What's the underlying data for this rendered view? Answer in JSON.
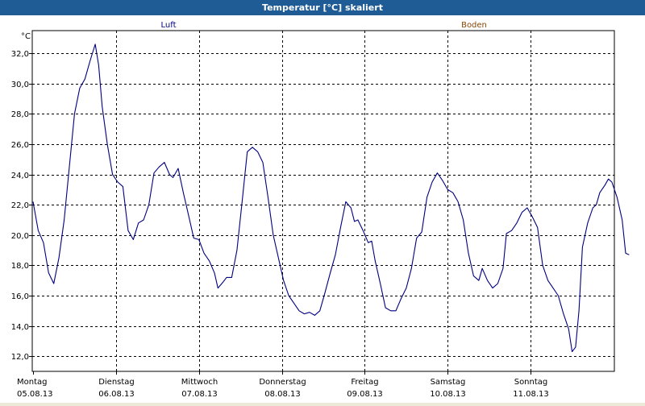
{
  "window": {
    "title": "Temperatur [°C] skaliert"
  },
  "colors": {
    "titlebar": "#1f5c96",
    "series_luft": "#000080",
    "series_boden": "#8b4500",
    "grid": "#000000"
  },
  "chart_data": {
    "type": "line",
    "title": "Temperatur [°C] skaliert",
    "ylabel": "°C",
    "ylim": [
      11.0,
      33.5
    ],
    "xlim": [
      "2013-08-05",
      "2013-08-12"
    ],
    "grid": true,
    "legend": [
      "Luft",
      "Boden"
    ],
    "yticks": [
      "12,0",
      "14,0",
      "16,0",
      "18,0",
      "20,0",
      "22,0",
      "24,0",
      "26,0",
      "28,0",
      "30,0",
      "32,0"
    ],
    "xticks": [
      {
        "day": "Montag",
        "date": "05.08.13"
      },
      {
        "day": "Dienstag",
        "date": "06.08.13"
      },
      {
        "day": "Mittwoch",
        "date": "07.08.13"
      },
      {
        "day": "Donnerstag",
        "date": "08.08.13"
      },
      {
        "day": "Freitag",
        "date": "09.08.13"
      },
      {
        "day": "Samstag",
        "date": "10.08.13"
      },
      {
        "day": "Sonntag",
        "date": "11.08.13"
      }
    ],
    "series": [
      {
        "name": "Luft",
        "points": [
          [
            "2013-08-05 00:00",
            22.2
          ],
          [
            "2013-08-05 01:30",
            20.3
          ],
          [
            "2013-08-05 03:00",
            19.5
          ],
          [
            "2013-08-05 04:30",
            17.5
          ],
          [
            "2013-08-05 06:00",
            16.8
          ],
          [
            "2013-08-05 07:30",
            18.5
          ],
          [
            "2013-08-05 09:00",
            21.0
          ],
          [
            "2013-08-05 10:30",
            24.5
          ],
          [
            "2013-08-05 12:00",
            28.0
          ],
          [
            "2013-08-05 13:30",
            29.7
          ],
          [
            "2013-08-05 15:00",
            30.3
          ],
          [
            "2013-08-05 16:30",
            31.5
          ],
          [
            "2013-08-05 18:00",
            32.6
          ],
          [
            "2013-08-05 19:00",
            31.2
          ],
          [
            "2013-08-05 20:00",
            28.5
          ],
          [
            "2013-08-05 21:30",
            26.0
          ],
          [
            "2013-08-05 23:00",
            24.0
          ],
          [
            "2013-08-06 00:30",
            23.5
          ],
          [
            "2013-08-06 02:00",
            23.2
          ],
          [
            "2013-08-06 03:30",
            20.3
          ],
          [
            "2013-08-06 05:00",
            19.7
          ],
          [
            "2013-08-06 06:30",
            20.8
          ],
          [
            "2013-08-06 08:00",
            21.0
          ],
          [
            "2013-08-06 09:30",
            22.0
          ],
          [
            "2013-08-06 11:00",
            24.1
          ],
          [
            "2013-08-06 12:30",
            24.5
          ],
          [
            "2013-08-06 14:00",
            24.8
          ],
          [
            "2013-08-06 15:30",
            24.0
          ],
          [
            "2013-08-06 16:30",
            23.8
          ],
          [
            "2013-08-06 18:00",
            24.4
          ],
          [
            "2013-08-06 19:30",
            22.8
          ],
          [
            "2013-08-06 21:00",
            21.3
          ],
          [
            "2013-08-06 22:30",
            19.8
          ],
          [
            "2013-08-07 00:00",
            19.7
          ],
          [
            "2013-08-07 01:30",
            18.8
          ],
          [
            "2013-08-07 03:00",
            18.3
          ],
          [
            "2013-08-07 04:30",
            17.5
          ],
          [
            "2013-08-07 05:30",
            16.5
          ],
          [
            "2013-08-07 07:00",
            16.9
          ],
          [
            "2013-08-07 08:00",
            17.2
          ],
          [
            "2013-08-07 09:30",
            17.2
          ],
          [
            "2013-08-07 11:00",
            19.0
          ],
          [
            "2013-08-07 12:30",
            22.2
          ],
          [
            "2013-08-07 14:00",
            25.5
          ],
          [
            "2013-08-07 15:30",
            25.8
          ],
          [
            "2013-08-07 17:00",
            25.5
          ],
          [
            "2013-08-07 18:30",
            24.8
          ],
          [
            "2013-08-07 20:00",
            22.5
          ],
          [
            "2013-08-07 21:30",
            20.0
          ],
          [
            "2013-08-07 23:00",
            18.5
          ],
          [
            "2013-08-08 00:30",
            17.0
          ],
          [
            "2013-08-08 02:00",
            16.0
          ],
          [
            "2013-08-08 03:30",
            15.5
          ],
          [
            "2013-08-08 05:00",
            15.0
          ],
          [
            "2013-08-08 06:30",
            14.8
          ],
          [
            "2013-08-08 08:00",
            14.9
          ],
          [
            "2013-08-08 09:30",
            14.7
          ],
          [
            "2013-08-08 11:00",
            15.0
          ],
          [
            "2013-08-08 12:30",
            16.2
          ],
          [
            "2013-08-08 14:00",
            17.5
          ],
          [
            "2013-08-08 15:30",
            18.7
          ],
          [
            "2013-08-08 17:00",
            20.5
          ],
          [
            "2013-08-08 18:30",
            22.2
          ],
          [
            "2013-08-08 20:00",
            21.8
          ],
          [
            "2013-08-08 21:00",
            20.9
          ],
          [
            "2013-08-08 22:00",
            21.0
          ],
          [
            "2013-08-08 23:30",
            20.3
          ],
          [
            "2013-08-09 01:00",
            19.5
          ],
          [
            "2013-08-09 02:00",
            19.6
          ],
          [
            "2013-08-09 03:00",
            18.3
          ],
          [
            "2013-08-09 04:30",
            16.8
          ],
          [
            "2013-08-09 06:00",
            15.2
          ],
          [
            "2013-08-09 07:30",
            15.0
          ],
          [
            "2013-08-09 09:00",
            15.0
          ],
          [
            "2013-08-09 10:30",
            15.8
          ],
          [
            "2013-08-09 12:00",
            16.5
          ],
          [
            "2013-08-09 13:30",
            17.8
          ],
          [
            "2013-08-09 15:00",
            19.8
          ],
          [
            "2013-08-09 16:30",
            20.2
          ],
          [
            "2013-08-09 18:00",
            22.5
          ],
          [
            "2013-08-09 19:30",
            23.5
          ],
          [
            "2013-08-09 21:00",
            24.1
          ],
          [
            "2013-08-09 22:30",
            23.6
          ],
          [
            "2013-08-10 00:00",
            23.0
          ],
          [
            "2013-08-10 01:30",
            22.8
          ],
          [
            "2013-08-10 03:00",
            22.2
          ],
          [
            "2013-08-10 04:30",
            21.0
          ],
          [
            "2013-08-10 06:00",
            18.8
          ],
          [
            "2013-08-10 07:30",
            17.3
          ],
          [
            "2013-08-10 09:00",
            17.0
          ],
          [
            "2013-08-10 10:00",
            17.8
          ],
          [
            "2013-08-10 11:30",
            17.0
          ],
          [
            "2013-08-10 13:00",
            16.5
          ],
          [
            "2013-08-10 14:30",
            16.8
          ],
          [
            "2013-08-10 16:00",
            17.8
          ],
          [
            "2013-08-10 17:00",
            20.1
          ],
          [
            "2013-08-10 18:30",
            20.3
          ],
          [
            "2013-08-10 20:00",
            20.8
          ],
          [
            "2013-08-10 21:30",
            21.5
          ],
          [
            "2013-08-10 23:00",
            21.8
          ],
          [
            "2013-08-11 00:30",
            21.2
          ],
          [
            "2013-08-11 02:00",
            20.5
          ],
          [
            "2013-08-11 03:30",
            18.0
          ],
          [
            "2013-08-11 05:00",
            17.0
          ],
          [
            "2013-08-11 06:30",
            16.5
          ],
          [
            "2013-08-11 08:00",
            16.0
          ],
          [
            "2013-08-11 09:30",
            14.8
          ],
          [
            "2013-08-11 11:00",
            13.8
          ],
          [
            "2013-08-11 12:00",
            12.3
          ],
          [
            "2013-08-11 13:00",
            12.6
          ],
          [
            "2013-08-11 14:00",
            15.0
          ],
          [
            "2013-08-11 15:00",
            19.2
          ],
          [
            "2013-08-11 16:30",
            20.8
          ],
          [
            "2013-08-11 18:00",
            21.8
          ],
          [
            "2013-08-11 19:00",
            22.0
          ],
          [
            "2013-08-11 20:00",
            22.8
          ],
          [
            "2013-08-11 21:30",
            23.3
          ],
          [
            "2013-08-11 22:30",
            23.7
          ],
          [
            "2013-08-11 23:30",
            23.5
          ],
          [
            "2013-08-12 01:00",
            22.5
          ],
          [
            "2013-08-12 02:30",
            21.0
          ],
          [
            "2013-08-12 03:30",
            18.8
          ],
          [
            "2013-08-12 04:30",
            18.7
          ]
        ]
      },
      {
        "name": "Boden",
        "points": []
      }
    ]
  }
}
